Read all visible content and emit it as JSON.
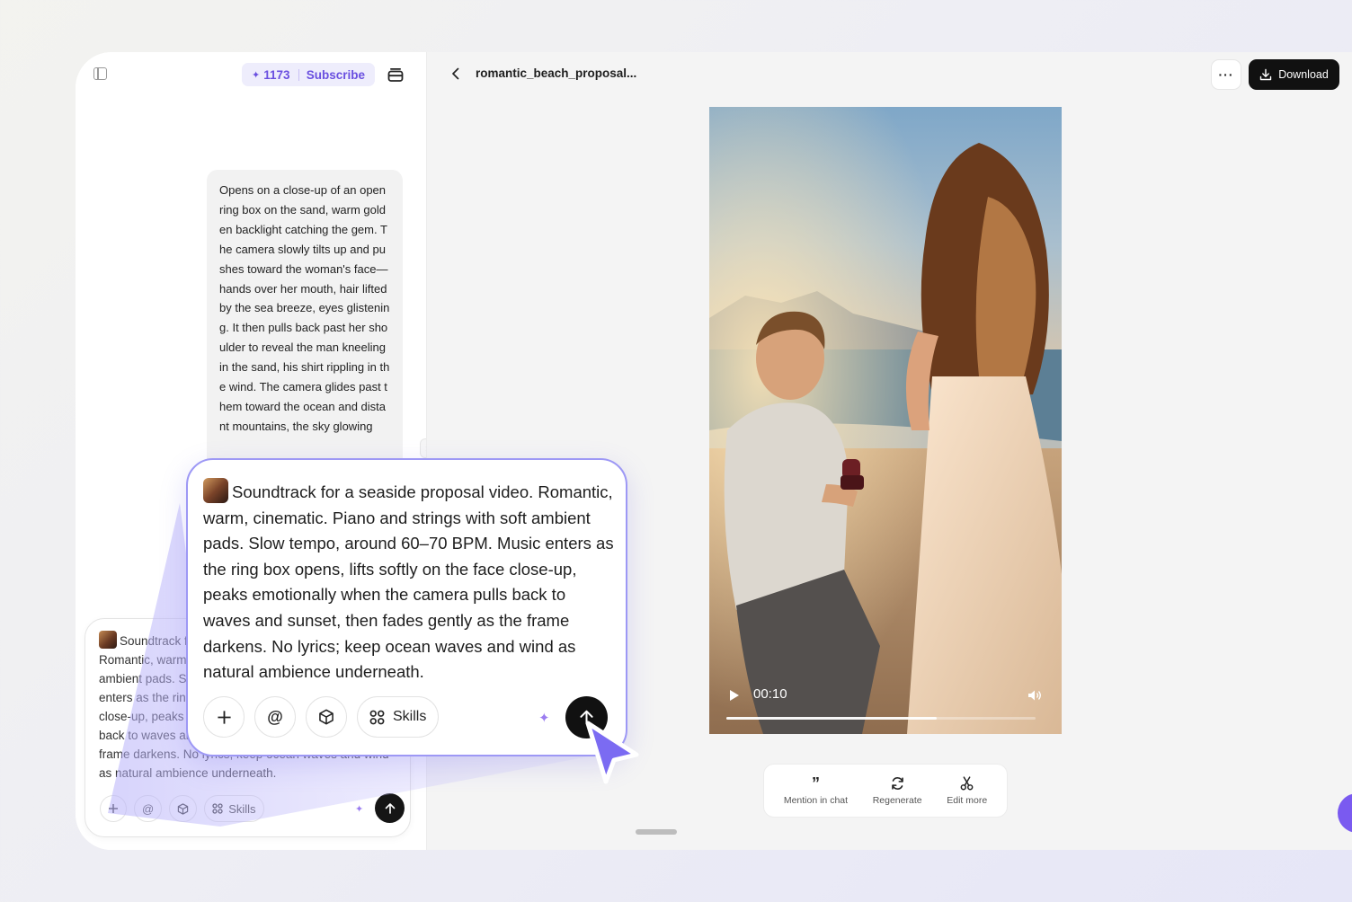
{
  "sidebar": {
    "credits": "1173",
    "subscribe_label": "Subscribe"
  },
  "chat": {
    "message": "Opens on a close-up of an open ring box on the sand, warm golden backlight catching the gem. The camera slowly tilts up and pushes toward the woman's face—hands over her mouth, hair lifted by the sea breeze, eyes glistening. It then pulls back past her shoulder to reveal the man kneeling in the sand, his shirt rippling in the wind. The camera glides past them toward the ocean and distant mountains, the sky glowing"
  },
  "composer": {
    "prompt": "Soundtrack for a seaside proposal video. Romantic, warm, cinematic. Piano and strings with soft ambient pads. Slow tempo, around 60–70 BPM. Music enters as the ring box opens, lifts softly on the face close-up, peaks emotionally when the camera pulls back to waves and sunset, then fades gently as the frame darkens. No lyrics; keep ocean waves and wind as natural ambience underneath.",
    "skills_label": "Skills"
  },
  "viewer": {
    "filename": "romantic_beach_proposal...",
    "download_label": "Download",
    "time": "00:10",
    "progress": 0.68,
    "actions": [
      {
        "label": "Mention in chat",
        "icon": "quote-icon"
      },
      {
        "label": "Regenerate",
        "icon": "refresh-icon"
      },
      {
        "label": "Edit more",
        "icon": "scissors-icon"
      }
    ]
  },
  "colors": {
    "accent": "#6a50e0",
    "highlight_border": "#9d98f5",
    "send_button": "#111111"
  }
}
